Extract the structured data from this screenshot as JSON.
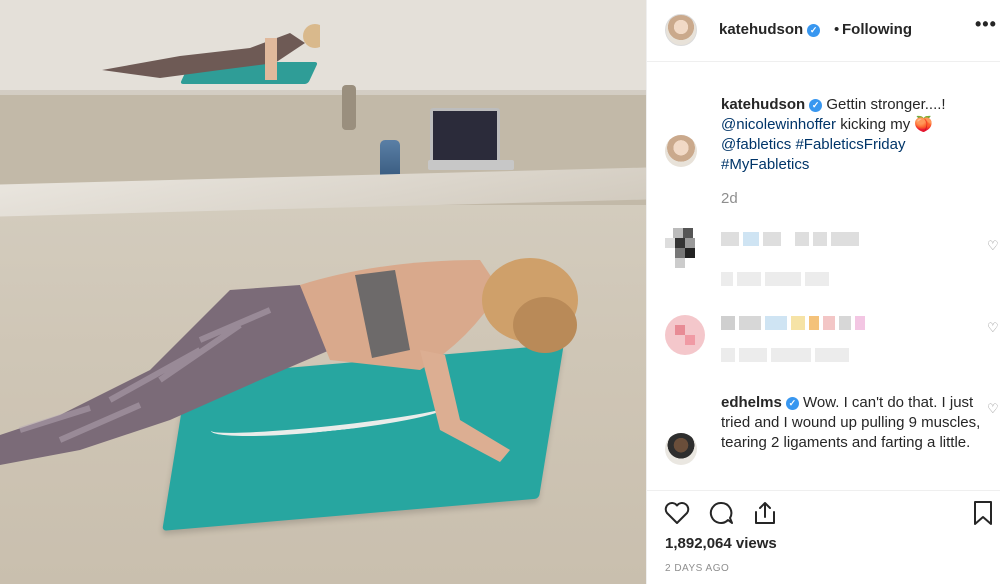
{
  "post": {
    "username": "katehudson",
    "separator": "•",
    "follow_status": "Following",
    "more_label": "•••"
  },
  "caption": {
    "username": "katehudson",
    "text_1": "Gettin stronger....!",
    "mention_1": "@nicolewinhoffer",
    "text_2": "kicking my",
    "emoji": "🍑",
    "mention_2": "@fabletics",
    "tag_1": "#FableticsFriday",
    "tag_2": "#MyFabletics",
    "time": "2d"
  },
  "comment_ed": {
    "username": "edhelms",
    "text": "Wow. I can't do that. I just tried and I wound up pulling 9 muscles, tearing 2 ligaments and farting a little."
  },
  "stats": {
    "views": "1,892,064 views",
    "posted": "2 DAYS AGO"
  },
  "icons": {
    "verified": "✓",
    "heart": "♡"
  },
  "colors": {
    "verified": "#3897f0",
    "mention": "#003569",
    "muted": "#8e8e8e",
    "mat": "#27a6a0"
  }
}
